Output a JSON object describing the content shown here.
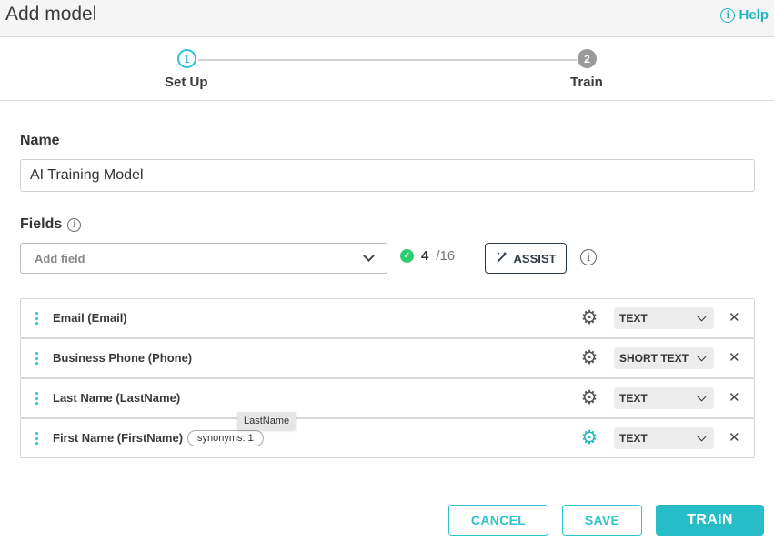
{
  "header": {
    "title": "Add model",
    "help_label": "Help"
  },
  "stepper": {
    "steps": [
      {
        "number": "1",
        "label": "Set Up"
      },
      {
        "number": "2",
        "label": "Train"
      }
    ]
  },
  "form": {
    "name_label": "Name",
    "name_value": "AI Training Model",
    "fields_label": "Fields",
    "add_field_placeholder": "Add field",
    "field_count": "4",
    "field_total": "/16",
    "assist_label": "ASSIST"
  },
  "fields": [
    {
      "name": "Email (Email)",
      "type": "TEXT"
    },
    {
      "name": "Business Phone (Phone)",
      "type": "SHORT TEXT"
    },
    {
      "name": "Last Name (LastName)",
      "type": "TEXT"
    },
    {
      "name": "First Name (FirstName)",
      "synonyms": "synonyms: 1",
      "type": "TEXT"
    }
  ],
  "tooltip": {
    "text": "LastName"
  },
  "footer": {
    "cancel_label": "CANCEL",
    "save_label": "SAVE",
    "train_label": "TRAIN"
  },
  "colors": {
    "accent": "#27bdc8",
    "success": "#2ecc71"
  }
}
